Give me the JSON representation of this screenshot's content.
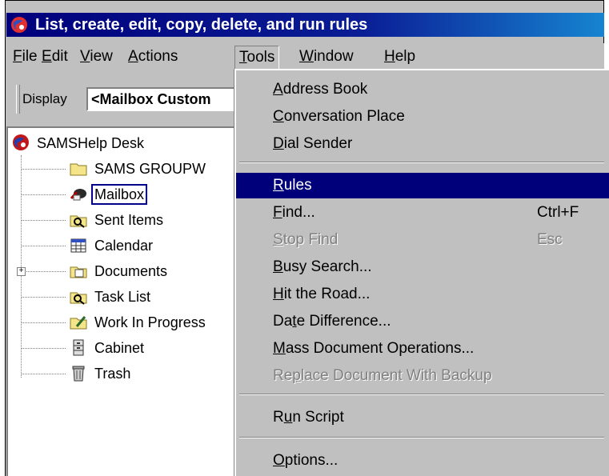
{
  "window": {
    "title": "List, create, edit, copy, delete, and run rules"
  },
  "menubar": {
    "items": [
      {
        "id": "file",
        "label": "File",
        "key": "F"
      },
      {
        "id": "edit",
        "label": "Edit",
        "key": "E"
      },
      {
        "id": "view",
        "label": "View",
        "key": "V"
      },
      {
        "id": "actions",
        "label": "Actions",
        "key": "A"
      },
      {
        "id": "tools",
        "label": "Tools",
        "key": "T",
        "active": true
      },
      {
        "id": "window",
        "label": "Window",
        "key": "W"
      },
      {
        "id": "help",
        "label": "Help",
        "key": "H"
      }
    ]
  },
  "toolbar": {
    "display_label": "Display",
    "display_value": "<Mailbox Custom"
  },
  "tree": {
    "root": "SAMSHelp Desk",
    "items": [
      {
        "label": "SAMS GROUPW",
        "icon": "folder-icon"
      },
      {
        "label": "Mailbox",
        "icon": "mailbox-icon",
        "selected": true
      },
      {
        "label": "Sent Items",
        "icon": "sent-items-icon"
      },
      {
        "label": "Calendar",
        "icon": "calendar-icon"
      },
      {
        "label": "Documents",
        "icon": "documents-icon",
        "expandable": true
      },
      {
        "label": "Task List",
        "icon": "task-list-icon"
      },
      {
        "label": "Work In Progress",
        "icon": "work-in-progress-icon"
      },
      {
        "label": "Cabinet",
        "icon": "cabinet-icon"
      },
      {
        "label": "Trash",
        "icon": "trash-icon"
      }
    ]
  },
  "tools_menu": {
    "group1": [
      {
        "label": "Address Book",
        "key": "A"
      },
      {
        "label": "Conversation Place",
        "key": "C"
      },
      {
        "label": "Dial Sender",
        "key": "D"
      }
    ],
    "group2": [
      {
        "label": "Rules",
        "key": "R",
        "highlighted": true
      },
      {
        "label": "Find...",
        "key": "F",
        "shortcut": "Ctrl+F"
      },
      {
        "label": "Stop Find",
        "key": "S",
        "shortcut": "Esc",
        "disabled": true
      },
      {
        "label": "Busy Search...",
        "key": "B"
      },
      {
        "label": "Hit the Road...",
        "key": "H"
      },
      {
        "label": "Date Difference...",
        "key": "t"
      },
      {
        "label": "Mass Document Operations...",
        "key": "M"
      },
      {
        "label": "Replace Document With Backup",
        "key": "p",
        "disabled": true
      }
    ],
    "group3": [
      {
        "label": "Run Script",
        "key": "u"
      }
    ],
    "group4": [
      {
        "label": "Options...",
        "key": "O"
      }
    ]
  },
  "colors": {
    "title_bar": "#00007b",
    "highlight": "#00007b",
    "face": "#c0c0c0"
  }
}
